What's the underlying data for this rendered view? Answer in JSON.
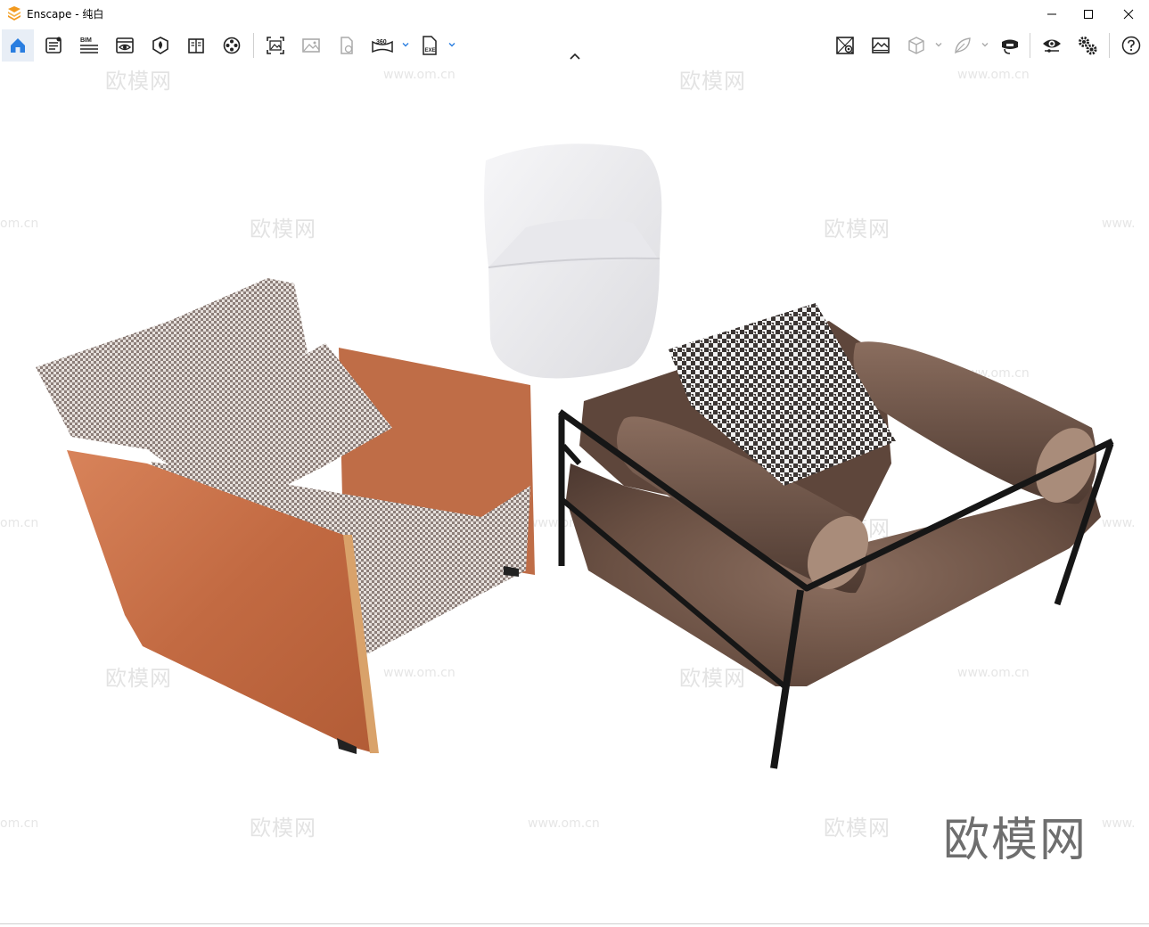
{
  "window": {
    "app_name": "Enscape",
    "title": "Enscape - 纯白",
    "minimize_icon": "minimize-icon",
    "maximize_icon": "maximize-icon",
    "close_icon": "close-icon"
  },
  "toolbar": {
    "left_tools": [
      {
        "name": "home",
        "icon": "home-icon",
        "active": true
      },
      {
        "name": "settings-file",
        "icon": "document-list-icon"
      },
      {
        "name": "bim",
        "icon": "bim-icon",
        "label": "BIM"
      },
      {
        "name": "views",
        "icon": "eye-window-icon"
      },
      {
        "name": "asset-library",
        "icon": "asset-library-icon"
      },
      {
        "name": "material-editor",
        "icon": "book-icon"
      },
      {
        "name": "video-editor",
        "icon": "film-reel-icon"
      },
      {
        "name": "screenshot",
        "icon": "screenshot-icon"
      },
      {
        "name": "batch-render",
        "icon": "image-icon"
      },
      {
        "name": "render-file",
        "icon": "file-render-icon"
      },
      {
        "name": "panorama",
        "icon": "panorama-360-icon",
        "label": "360"
      },
      {
        "name": "export-exe",
        "icon": "export-exe-icon",
        "label": "EXE"
      }
    ],
    "right_tools": [
      {
        "name": "map-view",
        "icon": "map-icon"
      },
      {
        "name": "site-context",
        "icon": "landscape-icon"
      },
      {
        "name": "box-view",
        "icon": "cube-icon"
      },
      {
        "name": "sketch",
        "icon": "leaf-icon"
      },
      {
        "name": "vr-headset",
        "icon": "vr-headset-icon"
      },
      {
        "name": "visual-settings",
        "icon": "eye-icon"
      },
      {
        "name": "general-settings",
        "icon": "gears-icon"
      },
      {
        "name": "help",
        "icon": "help-icon"
      }
    ],
    "collapse_icon": "chevron-up-icon",
    "accent_color": "#2a7ee0"
  },
  "viewport": {
    "watermarks": {
      "brand": "欧模网",
      "url": "www.om.cn",
      "partial_url_left": "om.cn",
      "partial_url_right": "www."
    },
    "brand_watermark": "欧模网",
    "objects": [
      {
        "name": "leather-armchair",
        "color": "#c8724a",
        "fabric": "houndstooth"
      },
      {
        "name": "white-tub-chair",
        "color": "#ececef"
      },
      {
        "name": "velvet-metal-sofa-chair",
        "color": "#6e5446",
        "frame": "#1a1a1a"
      }
    ]
  }
}
